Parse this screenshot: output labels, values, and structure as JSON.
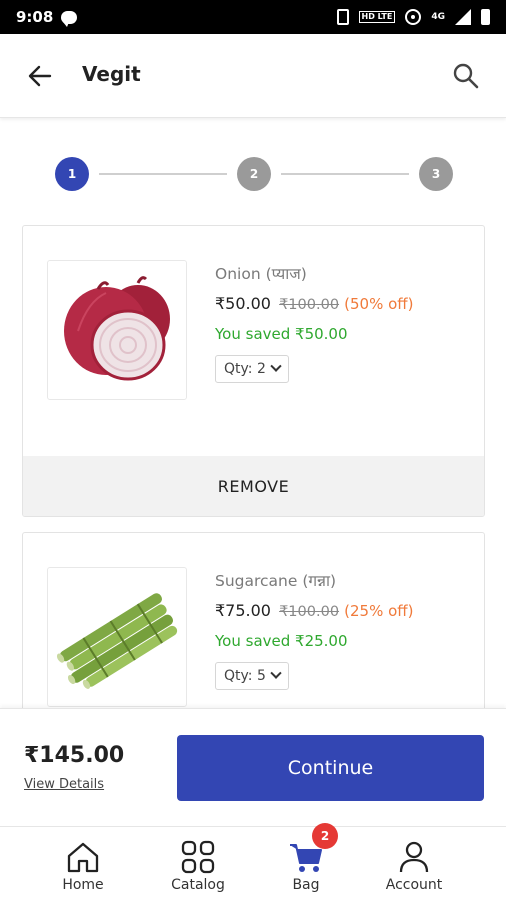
{
  "status_bar": {
    "time": "9:08",
    "net_type": "4G",
    "hd_label": "HD LTE"
  },
  "app_bar": {
    "title": "Vegit"
  },
  "stepper": {
    "steps": [
      "1",
      "2",
      "3"
    ],
    "current_step": 1
  },
  "cart_items": [
    {
      "name": "Onion (प्याज)",
      "price": "₹50.00",
      "mrp": "₹100.00",
      "discount": "(50% off)",
      "saved": "You saved ₹50.00",
      "qty_label": "Qty: 2",
      "remove_label": "REMOVE",
      "image": "onion-image"
    },
    {
      "name": "Sugarcane (गन्ना)",
      "price": "₹75.00",
      "mrp": "₹100.00",
      "discount": "(25% off)",
      "saved": "You saved ₹25.00",
      "qty_label": "Qty: 5",
      "image": "sugarcane-image"
    }
  ],
  "checkout": {
    "total": "₹145.00",
    "view_details": "View Details",
    "continue_label": "Continue"
  },
  "bottom_nav": {
    "items": [
      {
        "label": "Home",
        "icon": "home-icon"
      },
      {
        "label": "Catalog",
        "icon": "grid-icon"
      },
      {
        "label": "Bag",
        "icon": "cart-icon",
        "badge": "2"
      },
      {
        "label": "Account",
        "icon": "user-icon"
      }
    ]
  },
  "colors": {
    "primary": "#3346b3",
    "discount": "#f07a3a",
    "saved": "#2fa82f",
    "badge": "#e53935",
    "step_inactive": "#9a9a9a"
  }
}
